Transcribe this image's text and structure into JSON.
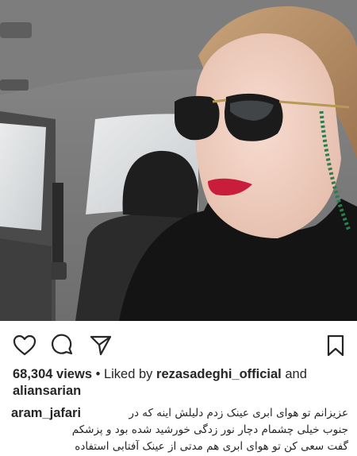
{
  "post": {
    "views_count": "68,304 views",
    "liked_prefix": "Liked by",
    "liked_user_1": "rezasadeghi_official",
    "liked_and": "and",
    "liked_user_2": "aliansarian"
  },
  "caption": {
    "author": "aram_jafari",
    "lines": [
      "عزیزانم تو هوای ابری عینک زدم دلیلش اینه که در",
      "جنوب خیلی چشمام دچار نور زدگی خورشید شده بود و پزشکم",
      "گفت سعی کن تو هوای ابری هم مدتی از عینک آفتابی استفاده"
    ]
  },
  "icons": {
    "like": "heart-icon",
    "comment": "comment-icon",
    "share": "paper-plane-icon",
    "save": "bookmark-icon"
  },
  "colors": {
    "text": "#262626",
    "background": "#ffffff"
  }
}
